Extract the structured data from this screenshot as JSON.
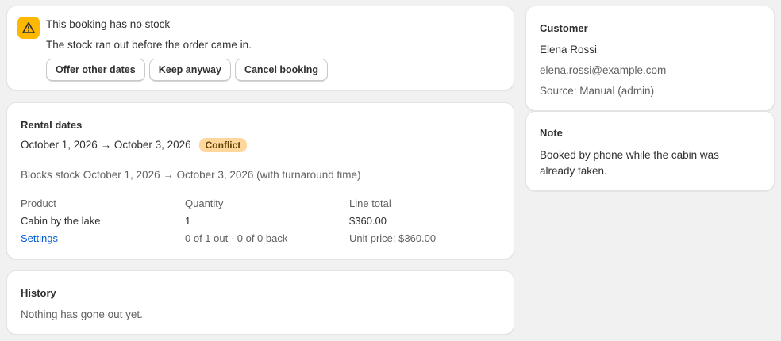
{
  "banner": {
    "icon": "warning-icon",
    "title": "This booking has no stock",
    "message": "The stock ran out before the order came in.",
    "buttons": [
      "Offer other dates",
      "Keep anyway",
      "Cancel booking"
    ]
  },
  "rental": {
    "heading": "Rental dates",
    "dates": "October 1, 2026 → October 3, 2026",
    "badge": "Conflict",
    "blocks": "Blocks stock October 1, 2026 → October 3, 2026 (with turnaround time)",
    "columns": [
      "Product",
      "Quantity",
      "Line total"
    ],
    "product": "Cabin by the lake",
    "settings_link": "Settings",
    "quantity": "1",
    "quantity_status": "0 of 1 out · 0 of 0 back",
    "line_total": "$360.00",
    "unit_price": "Unit price: $360.00"
  },
  "history": {
    "heading": "History",
    "text": "Nothing has gone out yet."
  },
  "customer": {
    "heading": "Customer",
    "name": "Elena Rossi",
    "email": "elena.rossi@example.com",
    "source": "Source: Manual (admin)"
  },
  "note": {
    "heading": "Note",
    "text": "Booked by phone while the cabin was already taken."
  },
  "colors": {
    "background": "#f1f1f1",
    "warning": "#ffb800",
    "badge": "#ffd79d",
    "link": "#005bd3"
  }
}
